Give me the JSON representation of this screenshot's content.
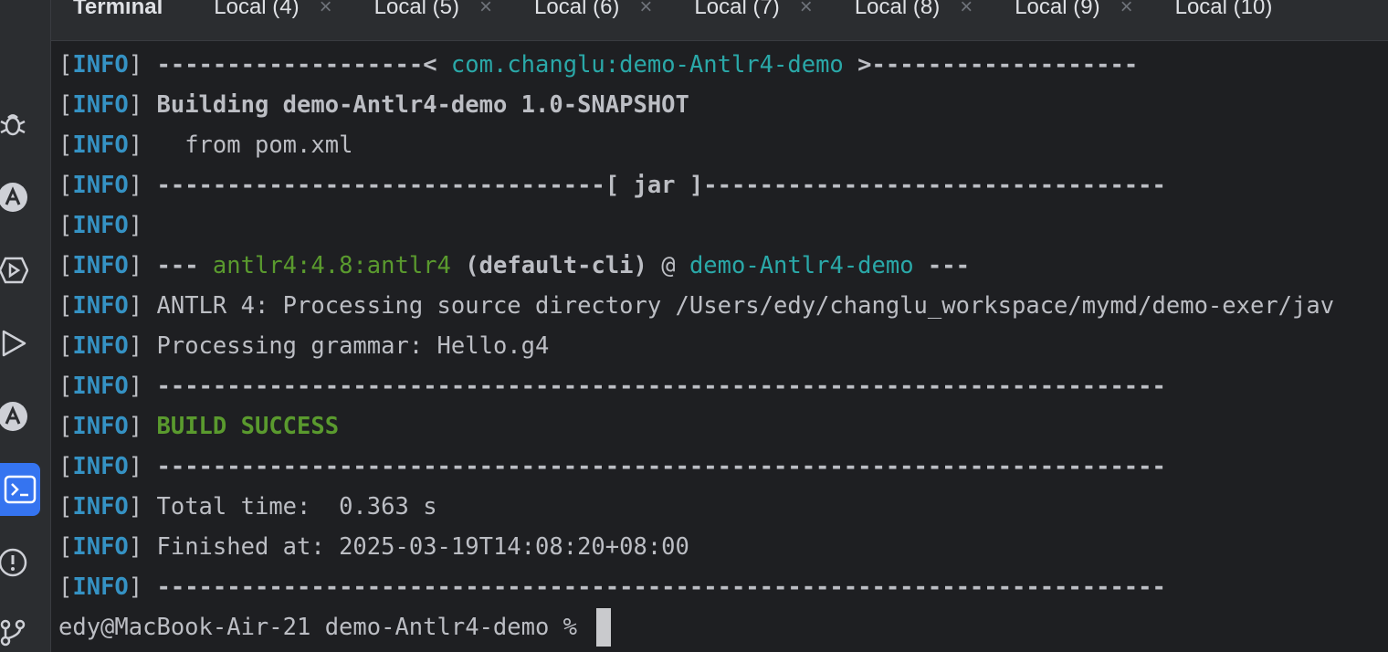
{
  "tabs": [
    {
      "label": "Terminal",
      "closable": false
    },
    {
      "label": "Local (4)",
      "closable": true
    },
    {
      "label": "Local (5)",
      "closable": true
    },
    {
      "label": "Local (6)",
      "closable": true
    },
    {
      "label": "Local (7)",
      "closable": true
    },
    {
      "label": "Local (8)",
      "closable": true
    },
    {
      "label": "Local (9)",
      "closable": true
    },
    {
      "label": "Local (10)",
      "closable": false
    }
  ],
  "tab_close_glyph": "×",
  "sidebar_icons": [
    "bug-icon",
    "ant-icon",
    "services-icon",
    "run-icon",
    "ant-build-icon",
    "terminal-icon",
    "problems-icon",
    "git-branch-icon"
  ],
  "terminal": {
    "lines": [
      [
        {
          "t": "[",
          "c": "bracket"
        },
        {
          "t": "INFO",
          "c": "info"
        },
        {
          "t": "] ",
          "c": "bracket"
        },
        {
          "t": "-------------------< ",
          "c": "bold"
        },
        {
          "t": "com.changlu:demo-Antlr4-demo",
          "c": "teal"
        },
        {
          "t": " >-------------------",
          "c": "bold"
        }
      ],
      [
        {
          "t": "[",
          "c": "bracket"
        },
        {
          "t": "INFO",
          "c": "info"
        },
        {
          "t": "] ",
          "c": "bracket"
        },
        {
          "t": "Building demo-Antlr4-demo 1.0-SNAPSHOT",
          "c": "bold"
        }
      ],
      [
        {
          "t": "[",
          "c": "bracket"
        },
        {
          "t": "INFO",
          "c": "info"
        },
        {
          "t": "] ",
          "c": "bracket"
        },
        {
          "t": "  from pom.xml",
          "c": "plain"
        }
      ],
      [
        {
          "t": "[",
          "c": "bracket"
        },
        {
          "t": "INFO",
          "c": "info"
        },
        {
          "t": "] ",
          "c": "bracket"
        },
        {
          "t": "--------------------------------[ jar ]---------------------------------",
          "c": "bold"
        }
      ],
      [
        {
          "t": "[",
          "c": "bracket"
        },
        {
          "t": "INFO",
          "c": "info"
        },
        {
          "t": "]",
          "c": "bracket"
        }
      ],
      [
        {
          "t": "[",
          "c": "bracket"
        },
        {
          "t": "INFO",
          "c": "info"
        },
        {
          "t": "] ",
          "c": "bracket"
        },
        {
          "t": "--- ",
          "c": "bold"
        },
        {
          "t": "antlr4:4.8:antlr4",
          "c": "green"
        },
        {
          "t": " ",
          "c": "plain"
        },
        {
          "t": "(default-cli)",
          "c": "bold"
        },
        {
          "t": " @ ",
          "c": "plain"
        },
        {
          "t": "demo-Antlr4-demo",
          "c": "teal"
        },
        {
          "t": " ---",
          "c": "bold"
        }
      ],
      [
        {
          "t": "[",
          "c": "bracket"
        },
        {
          "t": "INFO",
          "c": "info"
        },
        {
          "t": "] ",
          "c": "bracket"
        },
        {
          "t": "ANTLR 4: Processing source directory /Users/edy/changlu_workspace/mymd/demo-exer/jav",
          "c": "plain"
        }
      ],
      [
        {
          "t": "[",
          "c": "bracket"
        },
        {
          "t": "INFO",
          "c": "info"
        },
        {
          "t": "] ",
          "c": "bracket"
        },
        {
          "t": "Processing grammar: Hello.g4",
          "c": "plain"
        }
      ],
      [
        {
          "t": "[",
          "c": "bracket"
        },
        {
          "t": "INFO",
          "c": "info"
        },
        {
          "t": "] ",
          "c": "bracket"
        },
        {
          "t": "------------------------------------------------------------------------",
          "c": "bold"
        }
      ],
      [
        {
          "t": "[",
          "c": "bracket"
        },
        {
          "t": "INFO",
          "c": "info"
        },
        {
          "t": "] ",
          "c": "bracket"
        },
        {
          "t": "BUILD SUCCESS",
          "c": "green-bold"
        }
      ],
      [
        {
          "t": "[",
          "c": "bracket"
        },
        {
          "t": "INFO",
          "c": "info"
        },
        {
          "t": "] ",
          "c": "bracket"
        },
        {
          "t": "------------------------------------------------------------------------",
          "c": "bold"
        }
      ],
      [
        {
          "t": "[",
          "c": "bracket"
        },
        {
          "t": "INFO",
          "c": "info"
        },
        {
          "t": "] ",
          "c": "bracket"
        },
        {
          "t": "Total time:  0.363 s",
          "c": "plain"
        }
      ],
      [
        {
          "t": "[",
          "c": "bracket"
        },
        {
          "t": "INFO",
          "c": "info"
        },
        {
          "t": "] ",
          "c": "bracket"
        },
        {
          "t": "Finished at: 2025-03-19T14:08:20+08:00",
          "c": "plain"
        }
      ],
      [
        {
          "t": "[",
          "c": "bracket"
        },
        {
          "t": "INFO",
          "c": "info"
        },
        {
          "t": "] ",
          "c": "bracket"
        },
        {
          "t": "------------------------------------------------------------------------",
          "c": "bold"
        }
      ]
    ],
    "prompt": "edy@MacBook-Air-21 demo-Antlr4-demo % "
  },
  "colors": {
    "background": "#1e1f22",
    "panel": "#2b2d30",
    "info": "#3592c4",
    "teal": "#2aa8a8",
    "green": "#5a9a2e",
    "accent": "#3574f0"
  }
}
